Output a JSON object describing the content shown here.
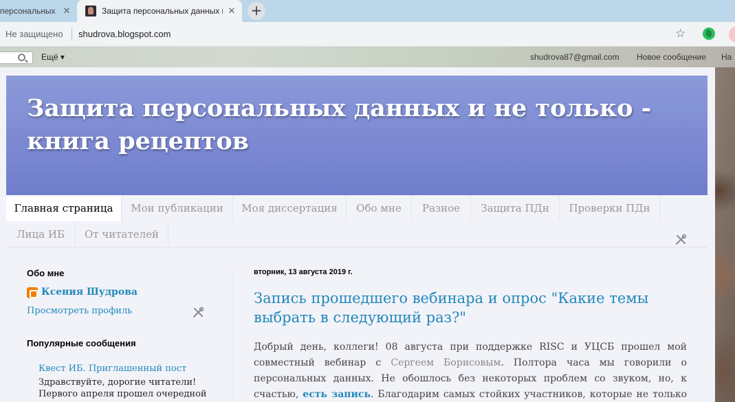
{
  "browser": {
    "tabs": [
      {
        "title": "персональных",
        "active": false
      },
      {
        "title": "Защита персональных данных и",
        "active": true
      }
    ],
    "new_tab_symbol": "+",
    "close_symbol": "✕",
    "security_label": "Не защищено",
    "url": "shudrova.blogspot.com",
    "icons": [
      "star-icon",
      "evernote-icon",
      "profile-icon"
    ]
  },
  "blogger_navbar": {
    "more_label": "Ещё ▾",
    "email": "shudrova87@gmail.com",
    "new_post": "Новое сообщение",
    "design_cut": "Ha"
  },
  "blog": {
    "title": "Защита персональных данных и не только - книга рецептов",
    "pages": [
      "Главная страница",
      "Мои публикации",
      "Моя диссертация",
      "Обо мне",
      "Разное",
      "Защита ПДн",
      "Проверки ПДн",
      "Лица ИБ",
      "От читателей"
    ],
    "selected_page": "Главная страница"
  },
  "sidebar": {
    "about_title": "Обо мне",
    "author_name": "Ксения Шудрова",
    "profile_link": "Просмотреть профиль",
    "popular_title": "Популярные сообщения",
    "popular_post_title": "Квест ИБ. Приглашенный пост",
    "popular_post_snippet": "Здравствуйте, дорогие читатели! Первого апреля прошел очередной"
  },
  "post": {
    "date": "вторник, 13 августа 2019 г.",
    "title": "Запись прошедшего вебинара и опрос \"Какие темы выбрать в следующий раз?\"",
    "body_1": "Добрый день, коллеги! 08 августа при поддержке RISC и УЦСБ прошел мой совместный вебинар с ",
    "body_link_1": "Сергеем Борисовым",
    "body_2": ". Полтора часа мы говорили о персональных данных. Не обошлось без некоторых проблем со звуком, но, к счастью, ",
    "body_link_2": "есть запись",
    "body_3": ". Благодарим самых стойких участников, которые не только досмотрели"
  },
  "colors": {
    "header_top": "#8b9ad9",
    "header_bottom": "#6f7dcb",
    "link": "#2288bb",
    "blog_bg": "#f2f3f8"
  }
}
